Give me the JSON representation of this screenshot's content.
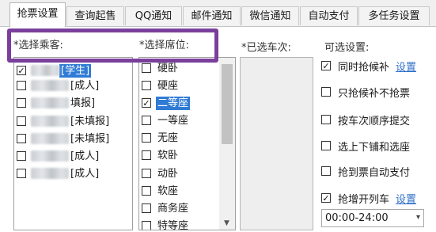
{
  "tabs": [
    "抢票设置",
    "查询起售",
    "QQ通知",
    "邮件通知",
    "微信通知",
    "自动支付",
    "多任务设置"
  ],
  "headers": {
    "passenger": "*选择乘客:",
    "seat": "*选择席位:",
    "selected_trains": "*已选车次:",
    "options": "可选设置:"
  },
  "passengers": [
    {
      "tag": "[学生]",
      "checked": true,
      "selected": true
    },
    {
      "tag": "[成人]",
      "checked": false,
      "selected": false
    },
    {
      "tag": "填报]",
      "checked": false,
      "selected": false
    },
    {
      "tag": "[未填报]",
      "checked": false,
      "selected": false
    },
    {
      "tag": "[未填报]",
      "checked": false,
      "selected": false
    },
    {
      "tag": "[成人]",
      "checked": false,
      "selected": false
    },
    {
      "tag": "[成人]",
      "checked": false,
      "selected": false
    }
  ],
  "seats": [
    {
      "label": "硬卧",
      "checked": false,
      "selected": false
    },
    {
      "label": "硬座",
      "checked": false,
      "selected": false
    },
    {
      "label": "二等座",
      "checked": true,
      "selected": true
    },
    {
      "label": "一等座",
      "checked": false,
      "selected": false
    },
    {
      "label": "无座",
      "checked": false,
      "selected": false
    },
    {
      "label": "软卧",
      "checked": false,
      "selected": false
    },
    {
      "label": "动卧",
      "checked": false,
      "selected": false
    },
    {
      "label": "软座",
      "checked": false,
      "selected": false
    },
    {
      "label": "商务座",
      "checked": false,
      "selected": false
    },
    {
      "label": "特等座",
      "checked": false,
      "selected": false
    }
  ],
  "options": [
    {
      "label": "同时抢候补",
      "checked": true,
      "link": "设置"
    },
    {
      "label": "只抢候补不抢票",
      "checked": false,
      "link": ""
    },
    {
      "label": "按车次顺序提交",
      "checked": false,
      "link": ""
    },
    {
      "label": "选上下铺和选座",
      "checked": false,
      "link": ""
    },
    {
      "label": "抢到票自动支付",
      "checked": false,
      "link": ""
    },
    {
      "label": "抢增开列车",
      "checked": true,
      "link": "设置"
    }
  ],
  "time_range": {
    "value": "00:00-24:00"
  },
  "colors": {
    "highlight": "#7a3f9c",
    "selection": "#2f7bd6",
    "link": "#2f6fc9"
  }
}
